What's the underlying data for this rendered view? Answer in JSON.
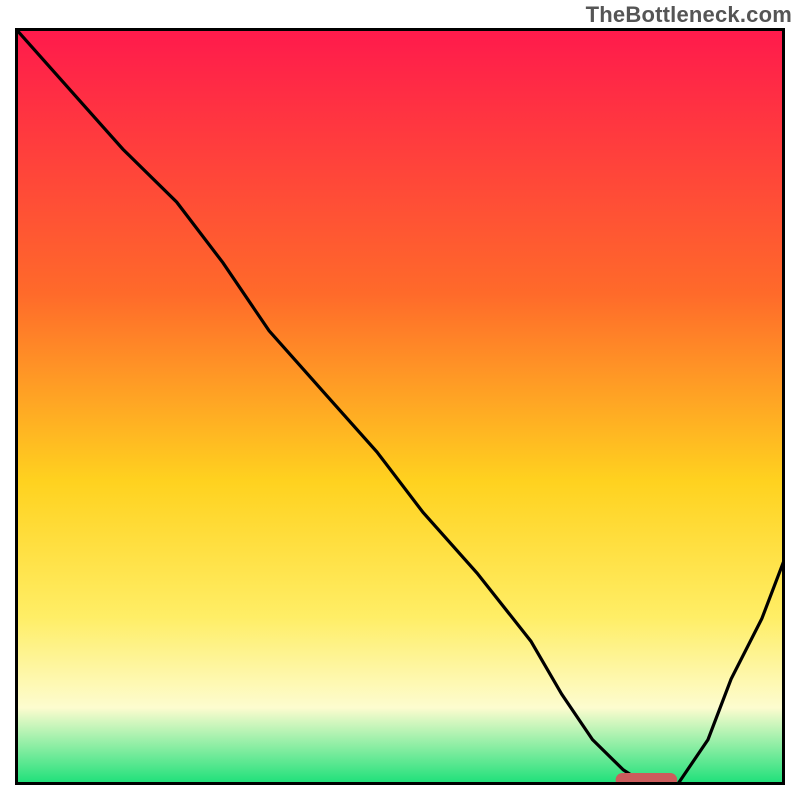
{
  "watermark": "TheBottleneck.com",
  "colors": {
    "gradient_top": "#ff1a4c",
    "gradient_mid1": "#ff6a2a",
    "gradient_mid2": "#ffd21f",
    "gradient_mid3": "#ffee66",
    "gradient_mid4": "#fdfccf",
    "gradient_bottom": "#1fe07a",
    "frame": "#000000",
    "line": "#000000",
    "marker": "#cc5c5c"
  },
  "chart_data": {
    "type": "line",
    "title": "",
    "xlabel": "",
    "ylabel": "",
    "xlim": [
      0,
      100
    ],
    "ylim": [
      0,
      100
    ],
    "grid": false,
    "legend": false,
    "series": [
      {
        "name": "curve",
        "x": [
          0,
          7,
          14,
          21,
          27,
          33,
          40,
          47,
          53,
          60,
          67,
          71,
          75,
          79,
          82,
          86,
          90,
          93,
          97,
          100
        ],
        "y": [
          100,
          92,
          84,
          77,
          69,
          60,
          52,
          44,
          36,
          28,
          19,
          12,
          6,
          2,
          0,
          0,
          6,
          14,
          22,
          30
        ]
      }
    ],
    "optimal_marker": {
      "x_start": 78,
      "x_end": 86,
      "y": 0
    }
  }
}
